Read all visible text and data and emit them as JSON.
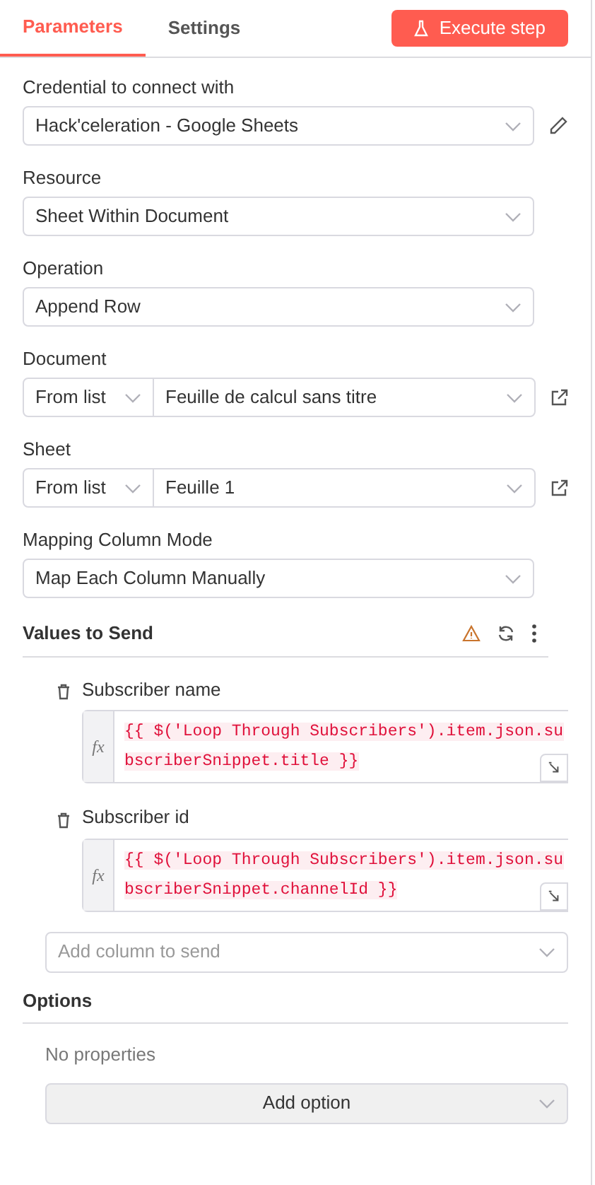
{
  "tabs": [
    {
      "label": "Parameters",
      "selected": true
    },
    {
      "label": "Settings",
      "selected": false
    }
  ],
  "execute_button": {
    "label": "Execute step"
  },
  "fields": [
    {
      "kind": "select",
      "label": "Credential to connect with",
      "value": "Hack'celeration - Google Sheets",
      "edit_icon": true
    },
    {
      "kind": "select",
      "label": "Resource",
      "value": "Sheet Within Document"
    },
    {
      "kind": "select",
      "label": "Operation",
      "value": "Append Row"
    },
    {
      "kind": "locator",
      "label": "Document",
      "mode": "From list",
      "value": "Feuille de calcul sans titre"
    },
    {
      "kind": "locator",
      "label": "Sheet",
      "mode": "From list",
      "value": "Feuille 1"
    },
    {
      "kind": "select",
      "label": "Mapping Column Mode",
      "value": "Map Each Column Manually"
    }
  ],
  "values_to_send": {
    "title": "Values to Send",
    "columns": [
      {
        "label": "Subscriber name",
        "fx_label": "fx",
        "expression": "{{ $('Loop Through Subscribers').item.json.subscriberSnippet.title }}"
      },
      {
        "label": "Subscriber id",
        "fx_label": "fx",
        "expression": "{{ $('Loop Through Subscribers').item.json.subscriberSnippet.channelId }}"
      }
    ],
    "add_column": {
      "placeholder": "Add column to send"
    }
  },
  "options": {
    "title": "Options",
    "empty_text": "No properties",
    "add_button": "Add option"
  }
}
